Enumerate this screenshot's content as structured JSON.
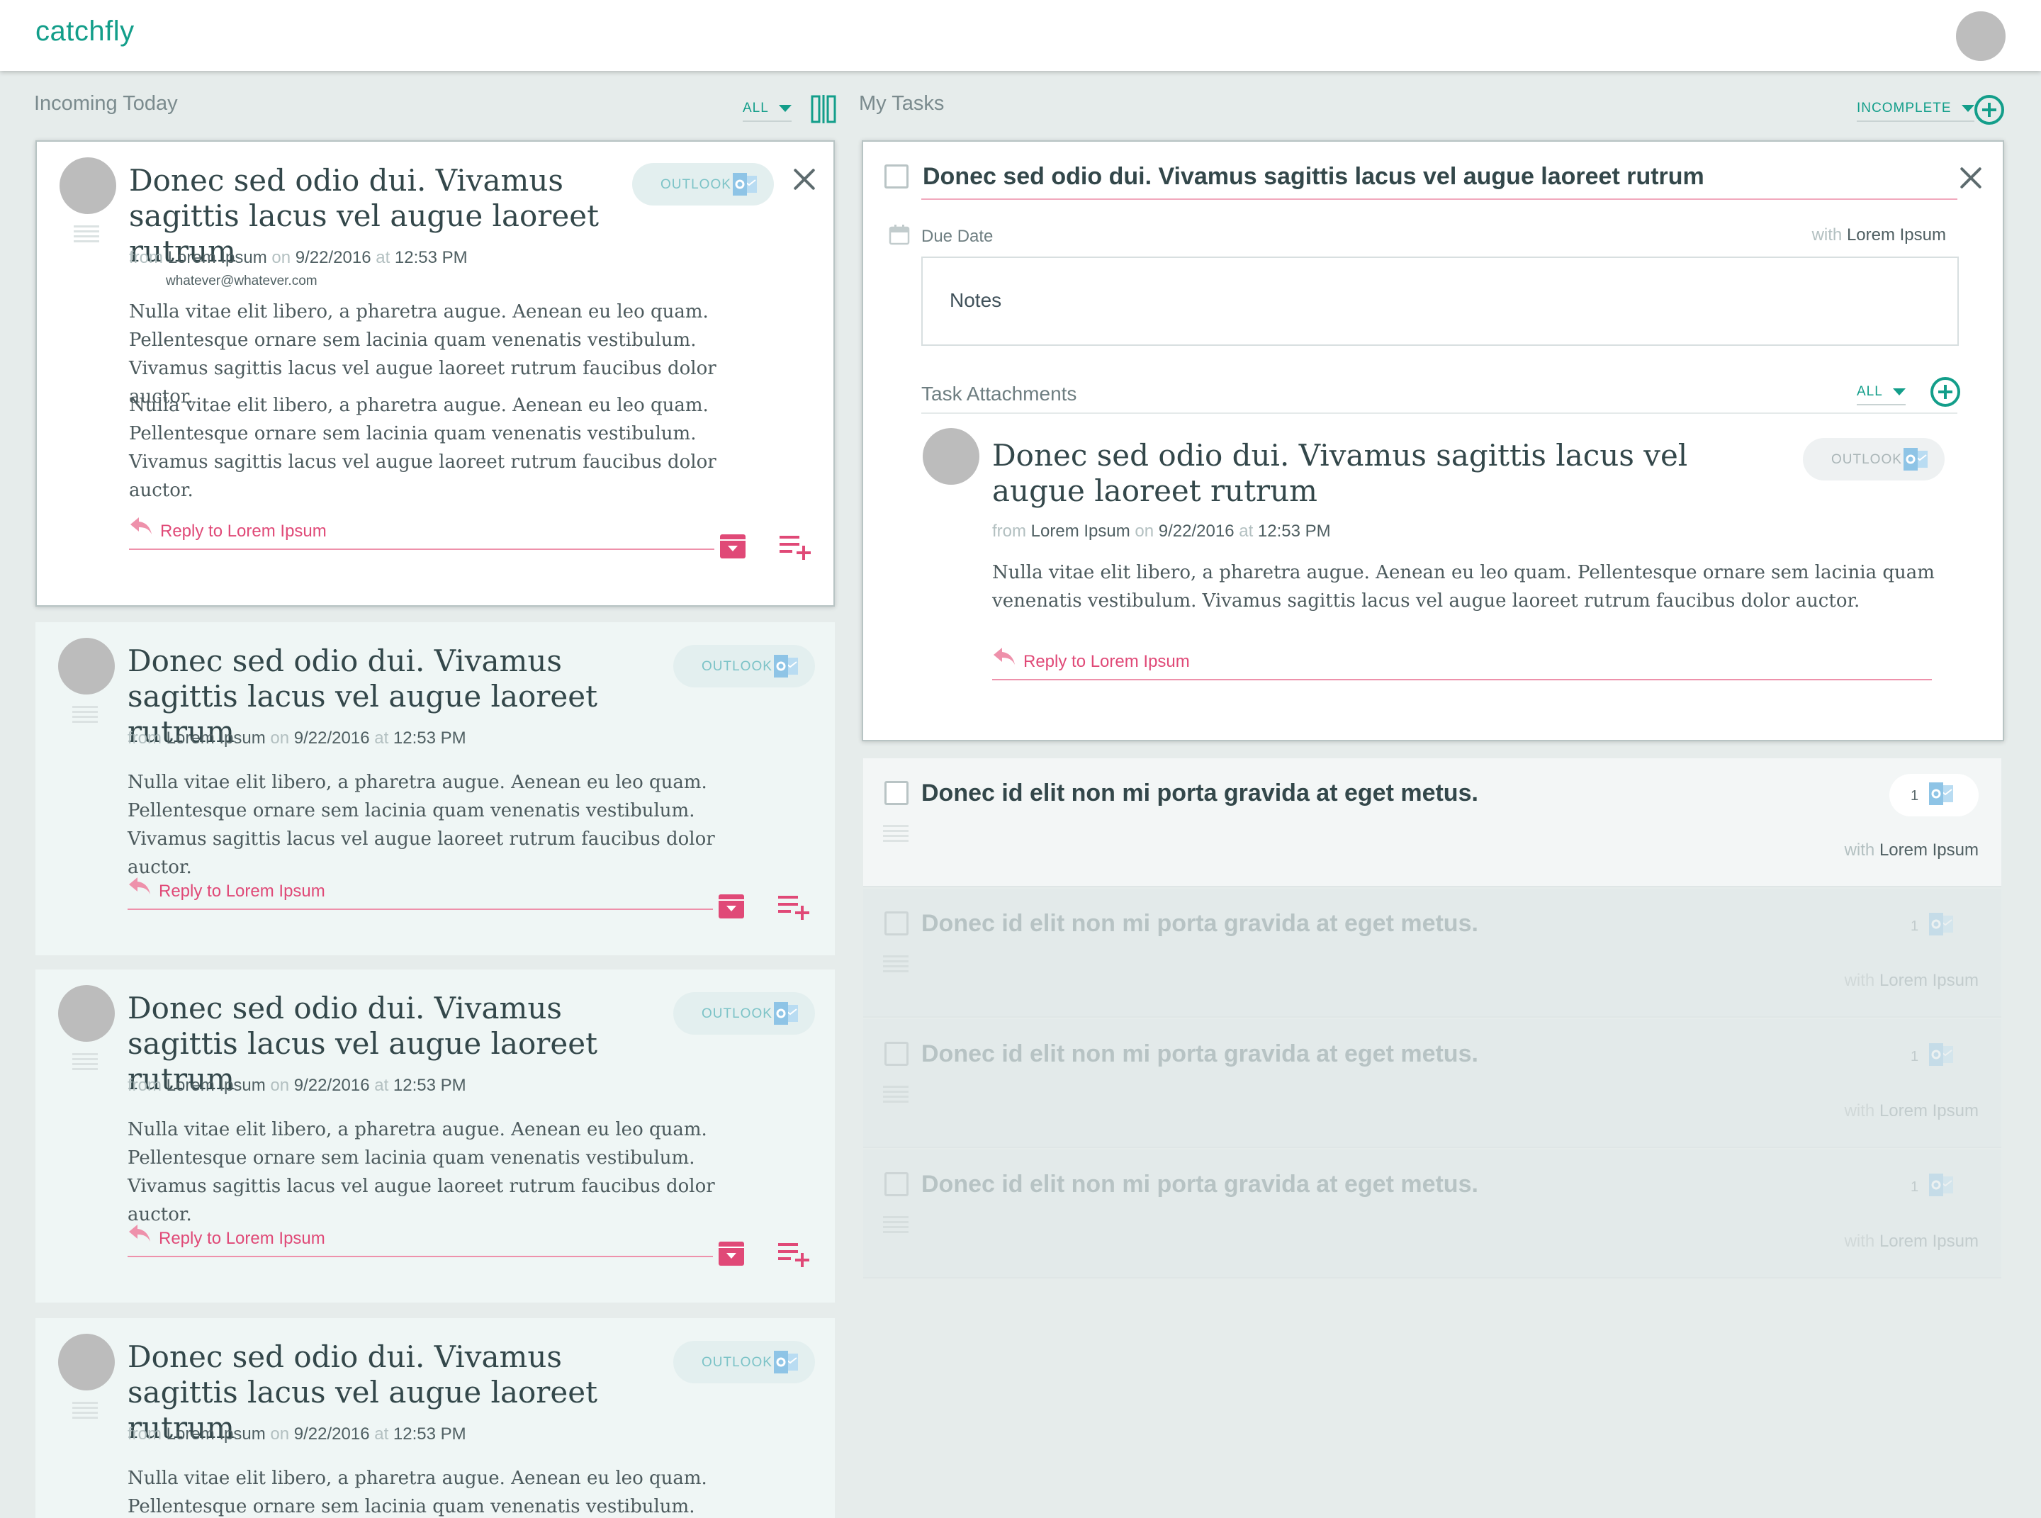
{
  "app": {
    "brand": "catchfly"
  },
  "incoming": {
    "header": "Incoming Today",
    "filter": "ALL",
    "cards": [
      {
        "subject": "Donec sed odio dui. Vivamus sagittis lacus vel augue laoreet rutrum",
        "source": "OUTLOOK",
        "from_label": "from",
        "from": "Lorem Ipsum",
        "on_label": "on",
        "date": "9/22/2016",
        "at_label": "at",
        "time": "12:53 PM",
        "email": "whatever@whatever.com",
        "paragraphs": [
          "Nulla vitae elit libero, a pharetra augue. Aenean eu leo quam. Pellentesque ornare sem lacinia quam venenatis vestibulum. Vivamus sagittis lacus vel augue laoreet rutrum faucibus dolor auctor.",
          "Nulla vitae elit libero, a pharetra augue. Aenean eu leo quam. Pellentesque ornare sem lacinia quam venenatis vestibulum. Vivamus sagittis lacus vel augue laoreet rutrum faucibus dolor auctor."
        ],
        "reply": "Reply to Lorem Ipsum"
      },
      {
        "subject": "Donec sed odio dui. Vivamus sagittis lacus vel augue laoreet rutrum",
        "source": "OUTLOOK",
        "from_label": "from",
        "from": "Lorem Ipsum",
        "on_label": "on",
        "date": "9/22/2016",
        "at_label": "at",
        "time": "12:53 PM",
        "paragraphs": [
          "Nulla vitae elit libero, a pharetra augue. Aenean eu leo quam. Pellentesque ornare sem lacinia quam venenatis vestibulum. Vivamus sagittis lacus vel augue laoreet rutrum faucibus dolor auctor."
        ],
        "reply": "Reply to Lorem Ipsum"
      },
      {
        "subject": "Donec sed odio dui. Vivamus sagittis lacus vel augue laoreet rutrum",
        "source": "OUTLOOK",
        "from_label": "from",
        "from": "Lorem Ipsum",
        "on_label": "on",
        "date": "9/22/2016",
        "at_label": "at",
        "time": "12:53 PM",
        "paragraphs": [
          "Nulla vitae elit libero, a pharetra augue. Aenean eu leo quam. Pellentesque ornare sem lacinia quam venenatis vestibulum. Vivamus sagittis lacus vel augue laoreet rutrum faucibus dolor auctor."
        ],
        "reply": "Reply to Lorem Ipsum"
      },
      {
        "subject": "Donec sed odio dui. Vivamus sagittis lacus vel augue laoreet rutrum",
        "source": "OUTLOOK",
        "from_label": "from",
        "from": "Lorem Ipsum",
        "on_label": "on",
        "date": "9/22/2016",
        "at_label": "at",
        "time": "12:53 PM",
        "paragraphs": [
          "Nulla vitae elit libero, a pharetra augue. Aenean eu leo quam. Pellentesque ornare sem lacinia quam venenatis vestibulum. Vivamus sagittis lacus vel augue laoreet rutrum faucibus dolor auctor."
        ]
      }
    ]
  },
  "tasks": {
    "header": "My Tasks",
    "filter": "INCOMPLETE",
    "open_task": {
      "title": "Donec sed odio dui. Vivamus sagittis lacus vel augue laoreet rutrum",
      "due_label": "Due Date",
      "with_label": "with",
      "with": "Lorem Ipsum",
      "notes_placeholder": "Notes",
      "attachments_label": "Task Attachments",
      "attachments_filter": "ALL",
      "attachment": {
        "subject": "Donec sed odio dui. Vivamus sagittis lacus vel augue laoreet rutrum",
        "source": "OUTLOOK",
        "from_label": "from",
        "from": "Lorem Ipsum",
        "on_label": "on",
        "date": "9/22/2016",
        "at_label": "at",
        "time": "12:53 PM",
        "body": "Nulla vitae elit libero, a pharetra augue. Aenean eu leo quam. Pellentesque ornare sem lacinia quam venenatis vestibulum. Vivamus sagittis lacus vel augue laoreet rutrum faucibus dolor auctor.",
        "reply": "Reply to Lorem Ipsum"
      }
    },
    "rows": [
      {
        "title": "Donec id elit non mi porta gravida at eget metus.",
        "count": "1",
        "with_label": "with",
        "with": "Lorem Ipsum"
      },
      {
        "title": "Donec id elit non mi porta gravida at eget metus.",
        "count": "1",
        "with_label": "with",
        "with": "Lorem Ipsum"
      },
      {
        "title": "Donec id elit non mi porta gravida at eget metus.",
        "count": "1",
        "with_label": "with",
        "with": "Lorem Ipsum"
      },
      {
        "title": "Donec id elit non mi porta gravida at eget metus.",
        "count": "1",
        "with_label": "with",
        "with": "Lorem Ipsum"
      }
    ]
  },
  "colors": {
    "brand": "#139e8a",
    "reply": "#e04977",
    "outlook": "#8ec4e6"
  },
  "icons": [
    "outlook-icon",
    "close-icon",
    "archive-icon",
    "add-to-tasks-icon",
    "reply-icon",
    "calendar-icon",
    "add-circle-icon",
    "split-view-icon",
    "drag-handle-icon",
    "caret-down-icon"
  ]
}
